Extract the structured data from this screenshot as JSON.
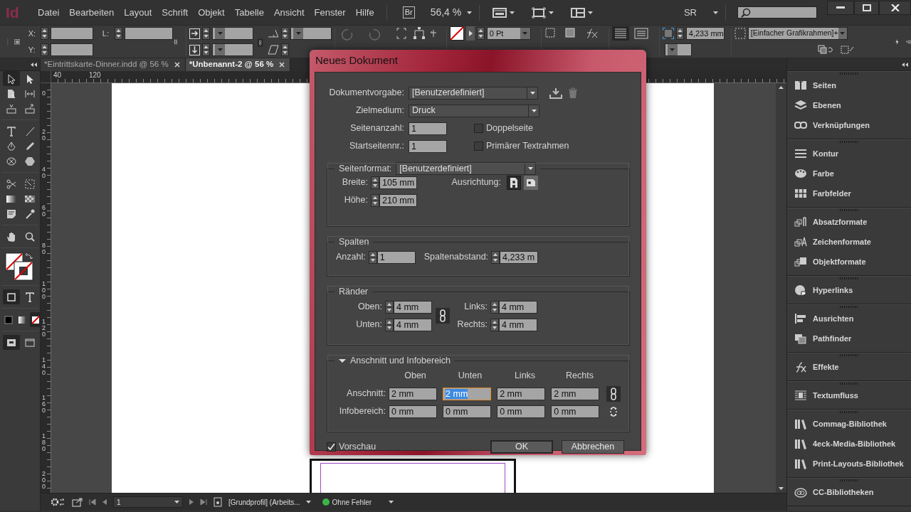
{
  "app": {
    "logo": "Id"
  },
  "menu": [
    "Datei",
    "Bearbeiten",
    "Layout",
    "Schrift",
    "Objekt",
    "Tabelle",
    "Ansicht",
    "Fenster",
    "Hilfe"
  ],
  "app_bar": {
    "bridge": "Br",
    "zoom": "56,4 %",
    "workspace": "SR"
  },
  "control_bar": {
    "x_label": "X:",
    "y_label": "Y:",
    "l_label": "L:",
    "stroke_weight": "0 Pt",
    "frame_size": "4,233 mm",
    "object_style": "[Einfacher Grafikrahmen]+"
  },
  "toolbox": {
    "tools": [
      {
        "selected": true
      },
      {
        "selected": false
      },
      {
        "selected": false
      },
      {
        "selected": false
      },
      {
        "selected": false
      },
      {
        "selected": false
      },
      {
        "selected": false
      },
      {
        "selected": false
      },
      {
        "selected": false
      },
      {
        "selected": false
      },
      {
        "selected": false
      },
      {
        "selected": false
      },
      {
        "selected": false
      },
      {
        "selected": false
      },
      {
        "selected": false
      },
      {
        "selected": false
      },
      {
        "selected": false
      },
      {
        "selected": false
      },
      {
        "selected": false
      },
      {
        "selected": false
      }
    ],
    "format_target": [
      {
        "selected": true
      },
      {
        "selected": false
      }
    ],
    "apply": [
      {
        "selected": false
      },
      {
        "selected": false
      },
      {
        "selected": true
      }
    ],
    "view_mode": [
      {
        "selected": true
      },
      {
        "selected": false
      }
    ]
  },
  "tabs": [
    {
      "label": "*Eintrittskarte-Dinner.indd @ 56 %",
      "selected": false
    },
    {
      "label": "*Unbenannt-2 @ 56 %",
      "selected": true
    }
  ],
  "rulers": {
    "horizontal": [
      "40",
      "120"
    ],
    "vertical": [
      "0",
      "20",
      "40",
      "60",
      "80",
      "100",
      "120",
      "140",
      "160",
      "180",
      "200"
    ]
  },
  "dialog": {
    "title": "Neues Dokument",
    "preset": {
      "label": "Dokumentvorgabe:",
      "value": "[Benutzerdefiniert]"
    },
    "intent": {
      "label": "Zielmedium:",
      "value": "Druck"
    },
    "pages": {
      "label": "Seitenanzahl:",
      "value": "1"
    },
    "start_page": {
      "label": "Startseitennr.:",
      "value": "1"
    },
    "facing_pages": {
      "label": "Doppelseite",
      "checked": false
    },
    "primary_frame": {
      "label": "Primärer Textrahmen",
      "checked": false
    },
    "page_size": {
      "label": "Seitenformat:",
      "value": "[Benutzerdefiniert]",
      "width_label": "Breite:",
      "width": "105 mm",
      "height_label": "Höhe:",
      "height": "210 mm",
      "orientation_label": "Ausrichtung:",
      "orientations": [
        {
          "kind": "portrait",
          "selected": true
        },
        {
          "kind": "landscape",
          "selected": false
        }
      ]
    },
    "columns": {
      "title": "Spalten",
      "count_label": "Anzahl:",
      "count": "1",
      "gutter_label": "Spaltenabstand:",
      "gutter": "4,233 m"
    },
    "margins": {
      "title": "Ränder",
      "linked": true,
      "fields": [
        {
          "label": "Oben:",
          "value": "4 mm"
        },
        {
          "label": "Links:",
          "value": "4 mm"
        },
        {
          "label": "Unten:",
          "value": "4 mm"
        },
        {
          "label": "Rechts:",
          "value": "4 mm"
        }
      ]
    },
    "bleed": {
      "title": "Anschnitt und Infobereich",
      "expanded": true,
      "columns": [
        "Oben",
        "Unten",
        "Links",
        "Rechts"
      ],
      "rows": [
        {
          "label": "Anschnitt:",
          "linked": true,
          "values": [
            {
              "value": "2 mm",
              "focused": false
            },
            {
              "value": "2 mm",
              "focused": true
            },
            {
              "value": "2 mm",
              "focused": false
            },
            {
              "value": "2 mm",
              "focused": false
            }
          ]
        },
        {
          "label": "Infobereich:",
          "linked": false,
          "values": [
            {
              "value": "0 mm",
              "focused": false
            },
            {
              "value": "0 mm",
              "focused": false
            },
            {
              "value": "0 mm",
              "focused": false
            },
            {
              "value": "0 mm",
              "focused": false
            }
          ]
        }
      ]
    },
    "preview": {
      "label": "Vorschau",
      "checked": true
    },
    "buttons": [
      {
        "label": "OK",
        "kind": "default"
      },
      {
        "label": "Abbrechen",
        "kind": "normal"
      }
    ]
  },
  "panels": [
    {
      "items": [
        "Seiten",
        "Ebenen",
        "Verknüpfungen"
      ]
    },
    {
      "items": [
        "Kontur",
        "Farbe",
        "Farbfelder"
      ]
    },
    {
      "items": [
        "Absatzformate",
        "Zeichenformate",
        "Objektformate"
      ]
    },
    {
      "items": [
        "Hyperlinks"
      ]
    },
    {
      "items": [
        "Ausrichten",
        "Pathfinder"
      ]
    },
    {
      "items": [
        "Effekte"
      ]
    },
    {
      "items": [
        "Textumfluss"
      ]
    },
    {
      "items": [
        "Commag-Bibliothek",
        "4eck-Media-Bibliothek",
        "Print-Layouts-Bibliothek"
      ]
    },
    {
      "items": [
        "CC-Bibliotheken"
      ]
    }
  ],
  "status_bar": {
    "page": "1",
    "profile": "[Grundprofil] (Arbeits...",
    "preflight": {
      "label": "Ohne Fehler",
      "ok": true
    }
  }
}
